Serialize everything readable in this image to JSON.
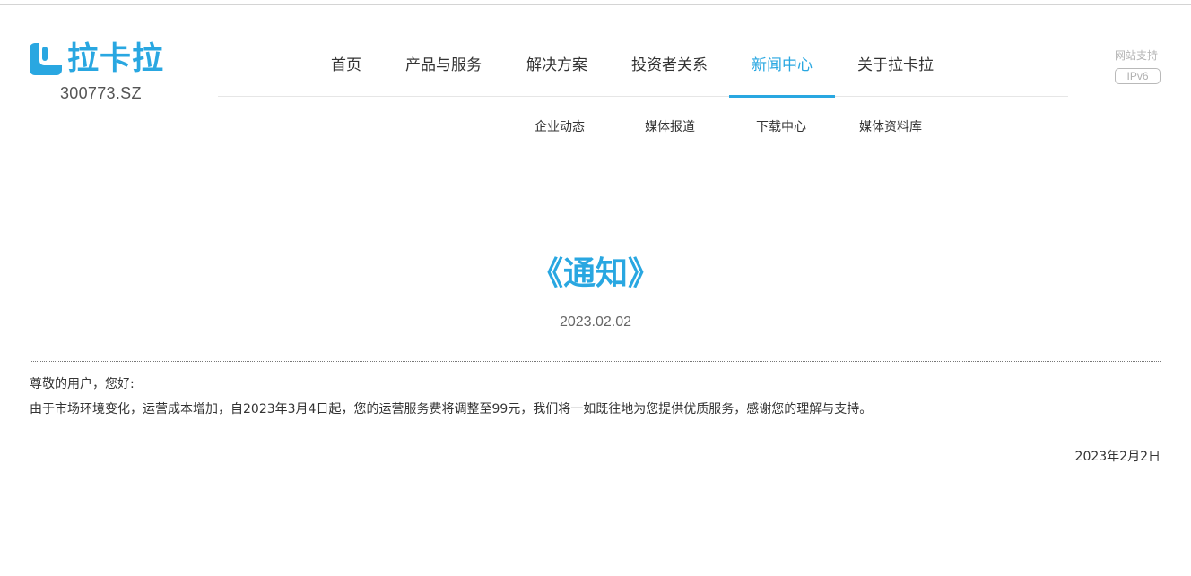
{
  "header": {
    "brand_name": "拉卡拉",
    "ticker": "300773.SZ",
    "accent_color": "#29a7e1"
  },
  "nav": {
    "items": [
      {
        "label": "首页"
      },
      {
        "label": "产品与服务"
      },
      {
        "label": "解决方案"
      },
      {
        "label": "投资者关系"
      },
      {
        "label": "新闻中心",
        "active": true
      },
      {
        "label": "关于拉卡拉"
      }
    ],
    "sub_items": [
      {
        "label": "企业动态"
      },
      {
        "label": "媒体报道"
      },
      {
        "label": "下载中心"
      },
      {
        "label": "媒体资料库"
      }
    ]
  },
  "ipv6": {
    "label": "网站支持",
    "badge": "IPv6"
  },
  "article": {
    "title": "《通知》",
    "date": "2023.02.02",
    "greeting": "尊敬的用户，您好:",
    "body": "由于市场环境变化，运营成本增加，自2023年3月4日起，您的运营服务费将调整至99元，我们将一如既往地为您提供优质服务，感谢您的理解与支持。",
    "sign_date": "2023年2月2日"
  }
}
